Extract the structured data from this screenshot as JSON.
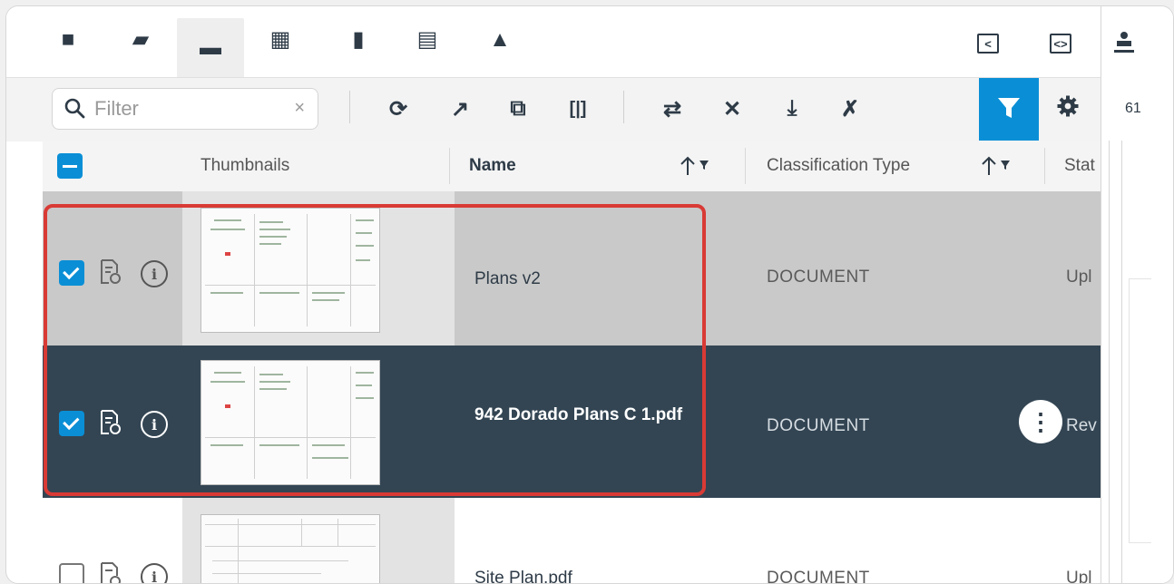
{
  "nav": {
    "tabs": [
      {
        "icon": "folder-icon",
        "glyph": "■"
      },
      {
        "icon": "folder-badge-icon",
        "glyph": "▰"
      },
      {
        "icon": "open-folder-icon",
        "glyph": "▬",
        "active": true
      },
      {
        "icon": "map-icon",
        "glyph": "▦"
      },
      {
        "icon": "bookmark-icon",
        "glyph": "▮"
      },
      {
        "icon": "document-icon",
        "glyph": "▤"
      },
      {
        "icon": "shield-document-icon",
        "glyph": "▲"
      }
    ],
    "right_icons": [
      "collapse-left-icon",
      "code-brackets-icon",
      "stamp-icon"
    ],
    "collapse_glyph": "<",
    "code_glyph": "<>"
  },
  "toolbar": {
    "filter_placeholder": "Filter",
    "clear_glyph": "×",
    "buttons": [
      {
        "icon": "refresh-icon",
        "glyph": "⟳"
      },
      {
        "icon": "open-external-icon",
        "glyph": "↗"
      },
      {
        "icon": "compare-icon",
        "glyph": "⧉"
      },
      {
        "icon": "split-icon",
        "glyph": "[|]"
      },
      {
        "icon": "transfer-icon",
        "glyph": "⇄"
      },
      {
        "icon": "tools-icon",
        "glyph": "✕"
      },
      {
        "icon": "download-icon",
        "glyph": "⤓"
      },
      {
        "icon": "file-exclude-icon",
        "glyph": "✗"
      }
    ],
    "filter_active_color": "#0a8fd6",
    "count_text": "61"
  },
  "grid": {
    "columns": {
      "thumbnails": "Thumbnails",
      "name": "Name",
      "classification": "Classification Type",
      "status": "Stat"
    },
    "rows": [
      {
        "name": "Plans v2",
        "classification": "DOCUMENT",
        "status": "Upl",
        "checked": true,
        "selected": false
      },
      {
        "name": "942 Dorado Plans C 1.pdf",
        "classification": "DOCUMENT",
        "status": "Rev",
        "checked": true,
        "selected": true
      },
      {
        "name": "Site Plan.pdf",
        "classification": "DOCUMENT",
        "status": "Upl",
        "checked": false,
        "selected": false
      }
    ],
    "more_glyph": "⋮"
  },
  "colors": {
    "accent": "#0a8fd6",
    "selected_row": "#334553",
    "highlight_border": "#d93a35"
  }
}
